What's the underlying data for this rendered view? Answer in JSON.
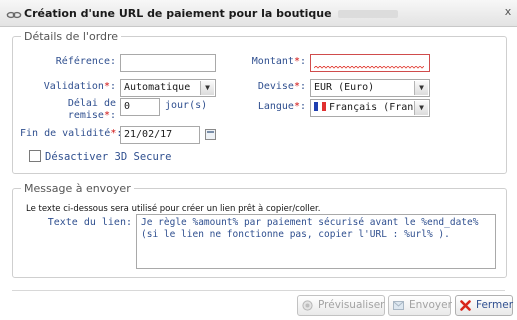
{
  "dialog": {
    "title": "Création d'une URL de paiement pour la boutique",
    "close_glyph": "x",
    "icon": "link-icon"
  },
  "order_details": {
    "legend": "Détails de l'ordre",
    "reference": {
      "label": "Référence:",
      "value": ""
    },
    "montant": {
      "label": "Montant",
      "required_mark": "*",
      "suffix": ":",
      "value": ""
    },
    "validation": {
      "label": "Validation",
      "required_mark": "*",
      "suffix": ":",
      "value": "Automatique"
    },
    "devise": {
      "label": "Devise",
      "required_mark": "*",
      "suffix": ":",
      "value": "EUR (Euro)"
    },
    "delai": {
      "label_line1": "Délai de",
      "label_line2": "remise",
      "required_mark": "*",
      "suffix": ":",
      "value": "0",
      "unit": "jour(s)"
    },
    "langue": {
      "label": "Langue",
      "required_mark": "*",
      "suffix": ":",
      "value": "Français (France"
    },
    "fin_validite": {
      "label": "Fin de validité",
      "required_mark": "*",
      "suffix": ":",
      "value": "21/02/17"
    },
    "disable_3ds": {
      "label": "Désactiver 3D Secure",
      "checked": false
    }
  },
  "message": {
    "legend": "Message à envoyer",
    "info": "Le texte ci-dessous sera utilisé pour créer un lien prêt à copier/coller.",
    "link_text_label": "Texte du lien:",
    "link_text_value": "Je règle %amount% par paiement sécurisé avant le %end_date% (si le lien ne fonctionne pas, copier l'URL : %url% )."
  },
  "buttons": {
    "preview": "Prévisualiser",
    "send": "Envoyer",
    "close": "Fermer"
  },
  "colors": {
    "label_blue": "#2f4f8f",
    "required_red": "#d01010",
    "close_red": "#d8261c"
  }
}
